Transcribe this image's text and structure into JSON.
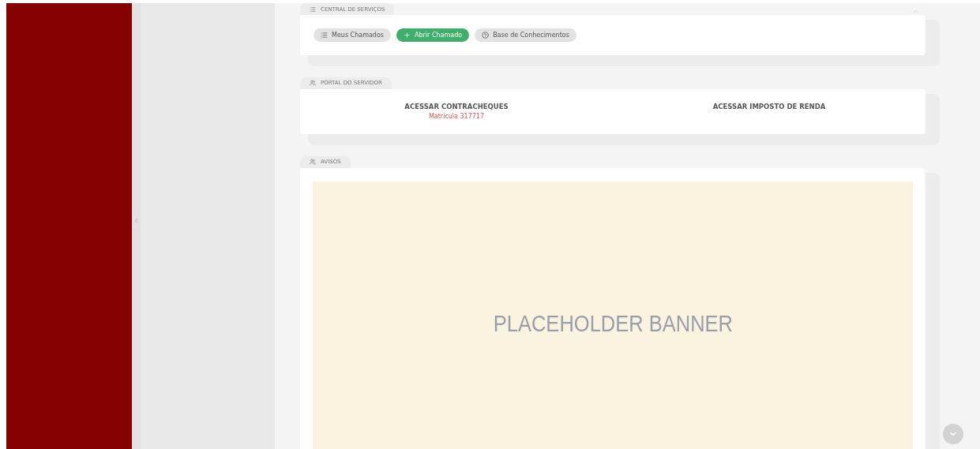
{
  "services": {
    "title": "CENTRAL DE SERVIÇOS",
    "buttons": [
      {
        "label": "Meus Chamados",
        "kind": "list",
        "primary": false
      },
      {
        "label": "Abrir Chamado",
        "kind": "plus",
        "primary": true
      },
      {
        "label": "Base de Conhecimentos",
        "kind": "help",
        "primary": false
      }
    ]
  },
  "portal": {
    "title": "PORTAL DO SERVIDOR",
    "links": [
      {
        "label": "ACESSAR CONTRACHEQUES",
        "note": "Matrícula 317717"
      },
      {
        "label": "ACESSAR IMPOSTO DE RENDA"
      }
    ]
  },
  "notices": {
    "title": "AVISOS",
    "banner": "PLACEHOLDER BANNER"
  }
}
